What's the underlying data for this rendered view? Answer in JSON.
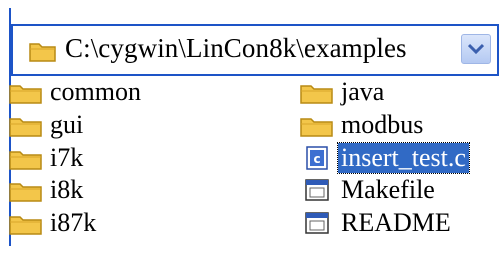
{
  "path_bar": {
    "path": "C:\\cygwin\\LinCon8k\\examples",
    "icon": "folder-icon",
    "dropdown_icon": "chevron-down-icon"
  },
  "files": [
    {
      "name": "common",
      "type": "folder",
      "icon": "folder-icon"
    },
    {
      "name": "gui",
      "type": "folder",
      "icon": "folder-icon"
    },
    {
      "name": "i7k",
      "type": "folder",
      "icon": "folder-icon"
    },
    {
      "name": "i8k",
      "type": "folder",
      "icon": "folder-icon"
    },
    {
      "name": "i87k",
      "type": "folder",
      "icon": "folder-icon"
    },
    {
      "name": "java",
      "type": "folder",
      "icon": "folder-icon"
    },
    {
      "name": "modbus",
      "type": "folder",
      "icon": "folder-icon"
    },
    {
      "name": "insert_test.c",
      "type": "c-source",
      "icon": "c-file-icon",
      "selected": true
    },
    {
      "name": "Makefile",
      "type": "file",
      "icon": "window-file-icon"
    },
    {
      "name": "README",
      "type": "file",
      "icon": "window-file-icon"
    }
  ],
  "colors": {
    "border": "#1d54c7",
    "selection": "#316ac5",
    "folder": "#f3c64a"
  }
}
